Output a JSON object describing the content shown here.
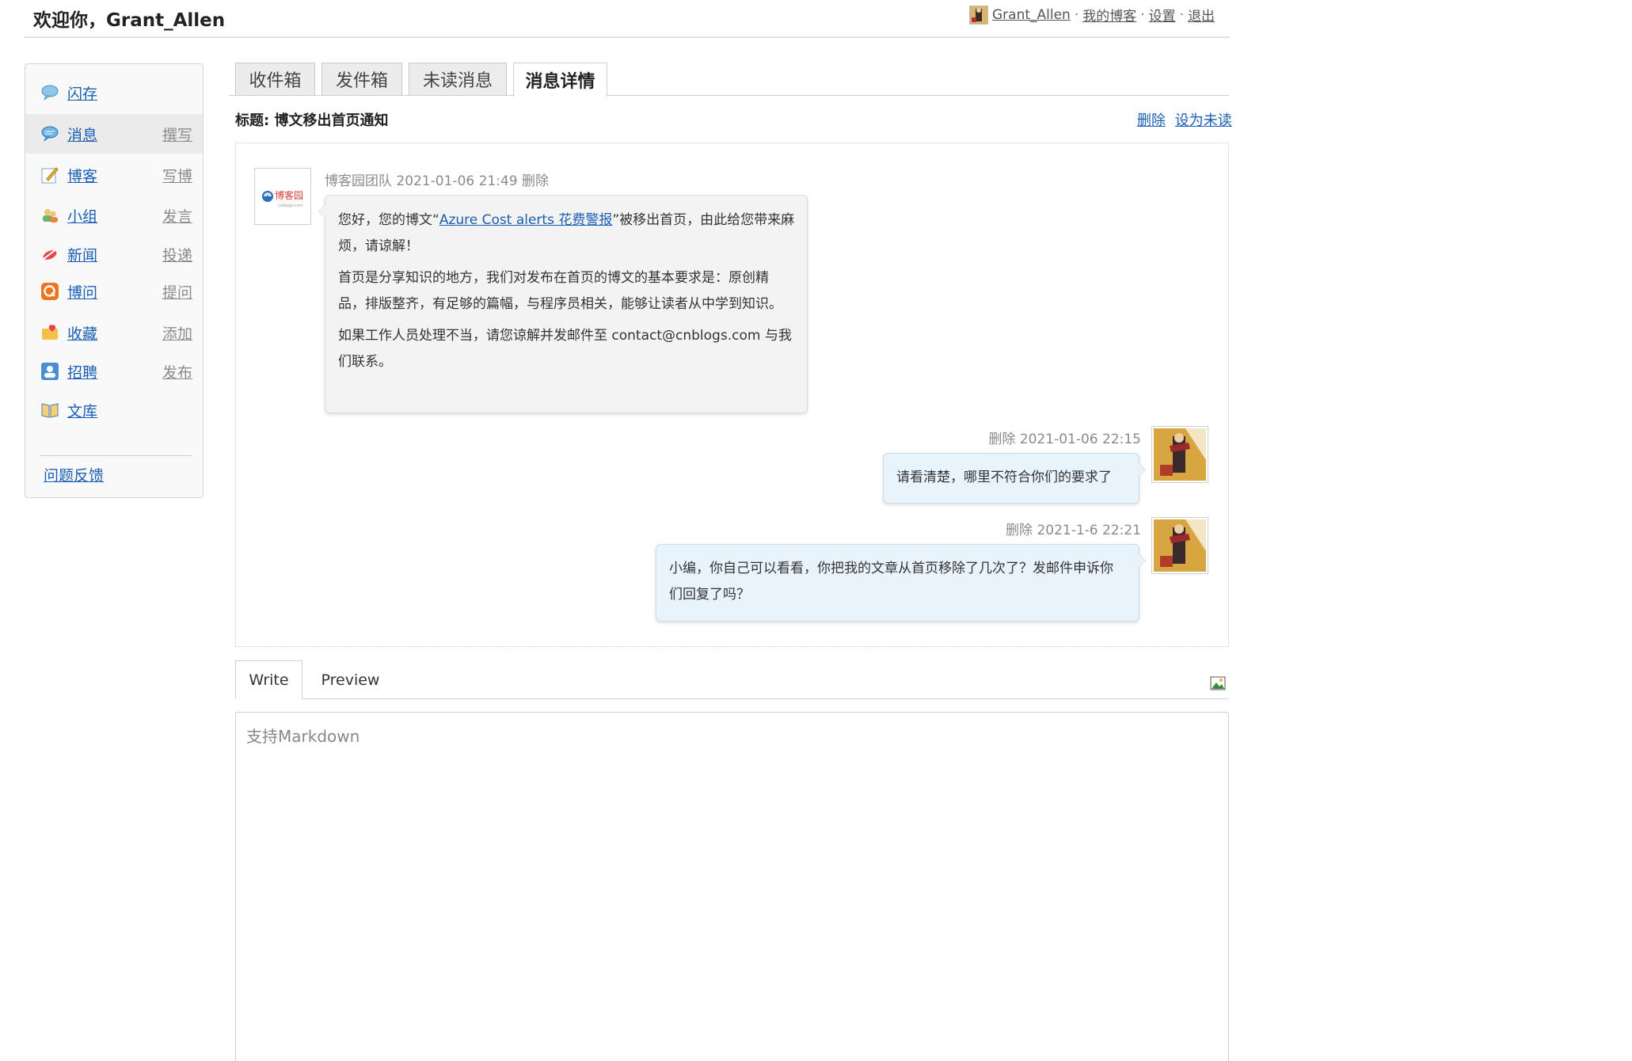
{
  "header": {
    "welcome": "欢迎你，Grant_Allen",
    "user_name": "Grant_Allen",
    "nav": [
      {
        "label": "我的博客"
      },
      {
        "label": "设置"
      },
      {
        "label": "退出"
      }
    ],
    "separator": "·"
  },
  "sidebar": {
    "items": [
      {
        "label": "闪存",
        "action": "",
        "icon": "chat-bubble-icon"
      },
      {
        "label": "消息",
        "action": "撰写",
        "icon": "message-icon"
      },
      {
        "label": "博客",
        "action": "写博",
        "icon": "pencil-note-icon"
      },
      {
        "label": "小组",
        "action": "发言",
        "icon": "group-icon"
      },
      {
        "label": "新闻",
        "action": "投递",
        "icon": "news-icon"
      },
      {
        "label": "博问",
        "action": "提问",
        "icon": "question-icon"
      },
      {
        "label": "收藏",
        "action": "添加",
        "icon": "favorite-folder-icon"
      },
      {
        "label": "招聘",
        "action": "发布",
        "icon": "recruit-icon"
      },
      {
        "label": "文库",
        "action": "",
        "icon": "book-icon"
      }
    ],
    "feedback": "问题反馈"
  },
  "tabs": [
    {
      "label": "收件箱",
      "active": false
    },
    {
      "label": "发件箱",
      "active": false
    },
    {
      "label": "未读消息",
      "active": false
    },
    {
      "label": "消息详情",
      "active": true
    }
  ],
  "message": {
    "subject": "标题: 博文移出首页通知",
    "actions": [
      {
        "label": "删除"
      },
      {
        "label": "设为未读"
      }
    ],
    "thread": [
      {
        "direction": "incoming",
        "sender": "博客园团队",
        "time": "2021-01-06 21:49",
        "delete_label": "删除",
        "paragraph1_prefix": "您好，您的博文“",
        "link_text": "Azure Cost alerts 花费警报",
        "paragraph1_suffix": "”被移出首页，由此给您带来麻烦，请谅解！",
        "paragraph2": "首页是分享知识的地方，我们对发布在首页的博文的基本要求是：原创精品，排版整齐，有足够的篇幅，与程序员相关，能够让读者从中学到知识。",
        "paragraph3": "如果工作人员处理不当，请您谅解并发邮件至 contact@cnblogs.com 与我们联系。",
        "logo_text": "博客园",
        "logo_sub": "cnblogs.com"
      },
      {
        "direction": "outgoing",
        "delete_label": "删除",
        "time": "2021-01-06 22:15",
        "text": "请看清楚，哪里不符合你们的要求了"
      },
      {
        "direction": "outgoing",
        "delete_label": "删除",
        "time": "2021-1-6 22:21",
        "text": "小编，你自己可以看看，你把我的文章从首页移除了几次了？发邮件申诉你们回复了吗？"
      }
    ]
  },
  "editor": {
    "tabs": [
      {
        "label": "Write",
        "active": true
      },
      {
        "label": "Preview",
        "active": false
      }
    ],
    "placeholder": "支持Markdown",
    "image_button_icon": "insert-image-icon"
  },
  "colors": {
    "link": "#1a5fb4",
    "incoming_bubble": "#f3f3f3",
    "outgoing_bubble": "#e8f3fc"
  }
}
